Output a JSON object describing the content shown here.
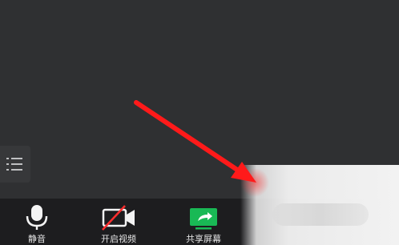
{
  "toolbar": {
    "items": [
      {
        "label": "静音",
        "icon": "microphone-icon"
      },
      {
        "label": "开启视频",
        "icon": "video-off-icon"
      },
      {
        "label": "共享屏幕",
        "icon": "share-screen-icon"
      }
    ]
  },
  "side": {
    "icon": "participant-list-icon"
  },
  "overlay": {
    "arrow_color": "#ff1a1a",
    "share_icon_color": "#19b955"
  }
}
